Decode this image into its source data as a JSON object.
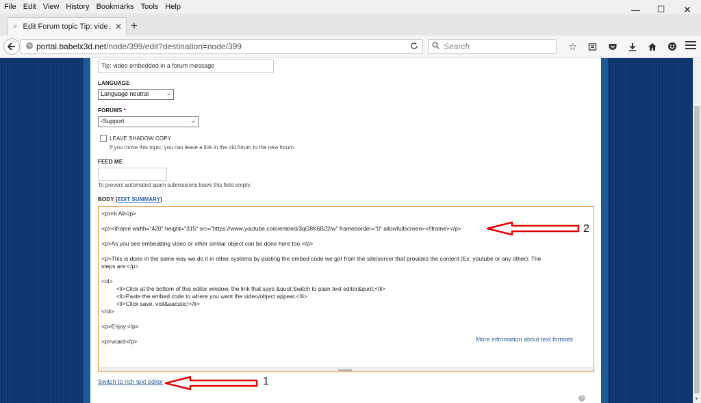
{
  "menubar": {
    "items": [
      "File",
      "Edit",
      "View",
      "History",
      "Bookmarks",
      "Tools",
      "Help"
    ]
  },
  "window": {
    "minimize_glyph": "—",
    "maximize_glyph": "☐",
    "close_glyph": "✕"
  },
  "tab": {
    "title": "Edit Forum topic Tip: vide…",
    "close_glyph": "✕",
    "new_tab_glyph": "+"
  },
  "navbar": {
    "url_host": "portal.babelx3d.net",
    "url_path": "/node/399/edit?destination=node/399",
    "search_placeholder": "Search"
  },
  "icons": {
    "back": "back-arrow-icon",
    "reload": "reload-icon",
    "toolbar": [
      "bookmark-star-icon",
      "reading-list-icon",
      "pocket-icon",
      "download-icon",
      "home-icon",
      "smiley-icon"
    ],
    "menu": "hamburger-menu-icon"
  },
  "form": {
    "title_value": "Tip: video embedded in a forum message",
    "language_label": "LANGUAGE",
    "language_value": "Language neutral",
    "forums_label": "FORUMS",
    "forums_required": "*",
    "forums_value": "-Support",
    "shadow_copy_label": "LEAVE SHADOW COPY",
    "shadow_copy_desc": "If you move this topic, you can leave a link in the old forum to the new forum.",
    "feedme_label": "FEED ME",
    "feedme_desc": "To prevent automated spam submissions leave this field empty.",
    "body_label": "BODY (",
    "edit_summary": "EDIT SUMMARY",
    "body_label_close": ")",
    "body_lines": [
      "<p>Hi All</p>",
      "<p><iframe width=\"420\" height=\"315\" src=\"https://www.youtube.com/embed/3qG8K6B22lw\" frameborder=\"0\" allowfullscreen></iframe></p>",
      "<p>As you see embedding video or other similar object can be done here too.</p>",
      "<p>This is done in the same way we do it in other systems by posting the embed code we got from the site/server that provides the content (Ex: youtube or any other): The",
      "steps are:</p>",
      "<ol>",
      "<li>Click at the bottom of this editor window, the link that says &quot;Switch to plain text editor&quot;</li>",
      "<li>Paste the embed code to where you want the video/object appear.</li>",
      "<li>Click save, voil&aacute;!</li>",
      "</ol>",
      "<p>Enjoy.</p>",
      "<p>vcard</p>"
    ],
    "switch_link": "Switch to rich text editor",
    "more_info": "More information about text formats"
  },
  "annotations": {
    "arrow1_label": "1",
    "arrow2_label": "2",
    "arrow_color": "#e00000"
  },
  "colors": {
    "page_bg": "#0d2f5f",
    "gutter": "#1d5a97",
    "editor_border": "#f08a24",
    "link": "#2b5f9a"
  }
}
